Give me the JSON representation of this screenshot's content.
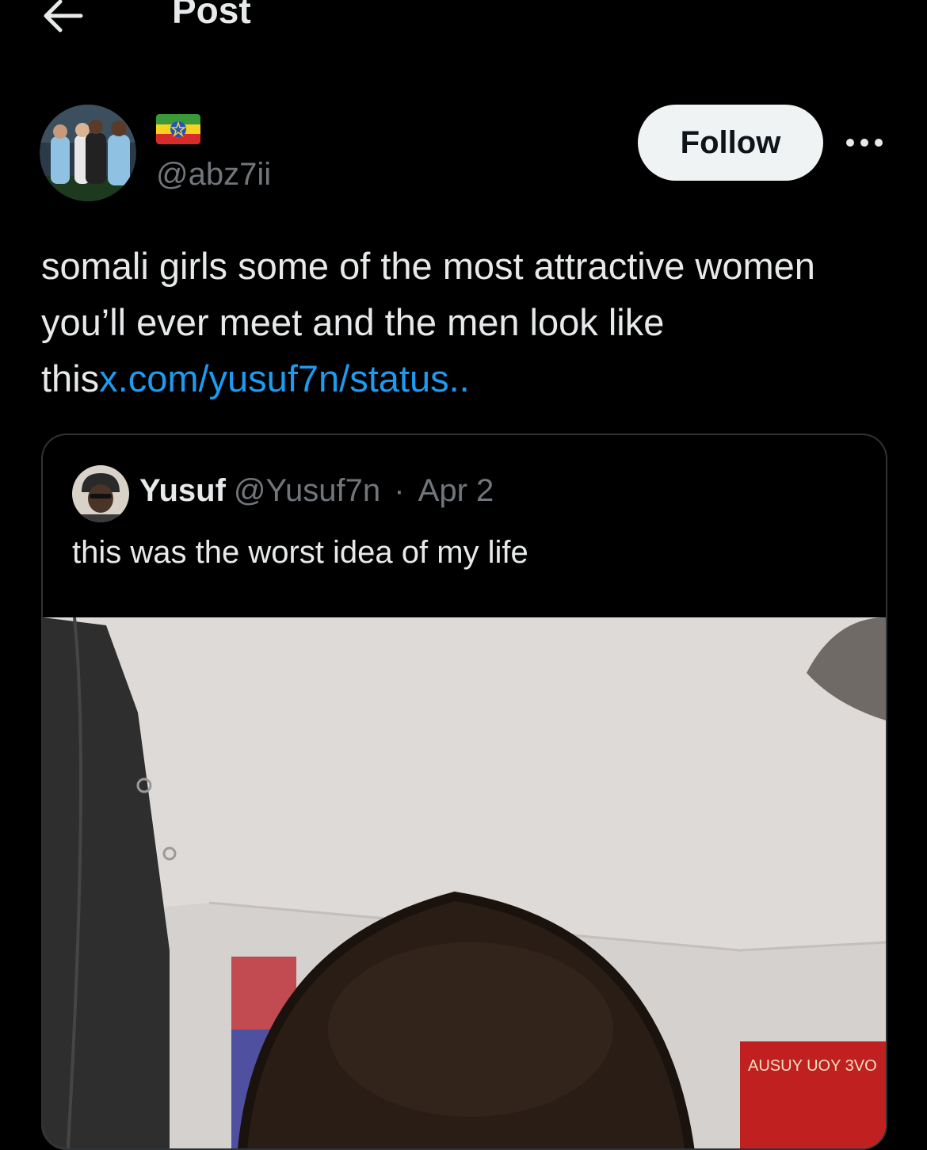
{
  "header": {
    "title": "Post"
  },
  "author": {
    "handle": "@abz7ii",
    "follow_label": "Follow"
  },
  "post": {
    "text": "somali girls some of the most attractive women you’ll ever meet and the men look like this",
    "link": "x.com/yusuf7n/status.."
  },
  "quoted": {
    "name": "Yusuf",
    "handle": "@Yusuf7n",
    "separator": "·",
    "date": "Apr 2",
    "text": "this was the worst idea of my life",
    "sign_text": "AUSUY UOY 3VO"
  },
  "colors": {
    "background": "#000000",
    "text": "#e7e9ea",
    "muted": "#71767b",
    "link": "#1d9bf0",
    "button_bg": "#eff3f4"
  },
  "icons": {
    "back": "arrow-left-icon",
    "more": "more-horizontal-icon",
    "flag": "ethiopia-flag-icon"
  }
}
